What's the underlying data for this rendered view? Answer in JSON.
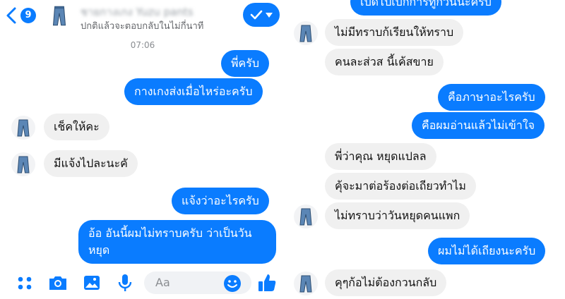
{
  "header": {
    "unread_count": "9",
    "contact_name": "ชายกางเกง Yuzu pants",
    "status": "ปกติแล้วจะตอบกลับในไม่กี่นาที"
  },
  "left_chat": {
    "timestamp": "07:06",
    "messages": [
      {
        "from": "me",
        "text": "พี่ครับ"
      },
      {
        "from": "me",
        "text": "กางเกงส่งเมื่อไหร่อะครับ"
      },
      {
        "from": "them",
        "text": "เช็คให้คะ"
      },
      {
        "from": "them",
        "text": "มีแจ้งไปละนะคั"
      },
      {
        "from": "me",
        "text": "แจ้งว่าอะไรครับ"
      },
      {
        "from": "me",
        "text": "อ้อ อันนี้ผมไม่ทราบครับ ว่าเป็นวันหยุด"
      }
    ]
  },
  "composer": {
    "placeholder": "Aa"
  },
  "right_chat": {
    "messages": [
      {
        "from": "me",
        "text": "เปิดไปเบิกการทูกวันนะครับ"
      },
      {
        "from": "them",
        "text": "ไม่มีทราบก้เรียนให้ทราบ"
      },
      {
        "from": "them",
        "text": "คนละส่วส นี้เค้สขาย"
      },
      {
        "from": "me",
        "text": "คือภาษาอะไรครับ"
      },
      {
        "from": "me",
        "text": "คือผมอ่านแล้วไม่เข้าใจ"
      },
      {
        "from": "them",
        "text": "พี่ว่าคุณ หยุดแปลล"
      },
      {
        "from": "them",
        "text": "คุ้จะมาต่อร้องต่อเถียวทำไม"
      },
      {
        "from": "them",
        "text": "ไม่ทราบว่าวันหยุดคนแพก"
      },
      {
        "from": "me",
        "text": "ผมไม่ได้เถียงนะครับ"
      },
      {
        "from": "them",
        "text": "คุๆก้อไม่ต้องกวนกลับ"
      }
    ]
  },
  "colors": {
    "accent": "#0a7cff",
    "incoming_bubble": "#f0f0f0",
    "text_dark": "#111111",
    "text_muted": "#65676b"
  },
  "icons": [
    "chevron-left-icon",
    "check-icon",
    "chevron-down-icon",
    "menu-dots-icon",
    "camera-icon",
    "image-icon",
    "microphone-icon",
    "emoji-icon",
    "thumbs-up-icon",
    "jeans-avatar-icon"
  ]
}
